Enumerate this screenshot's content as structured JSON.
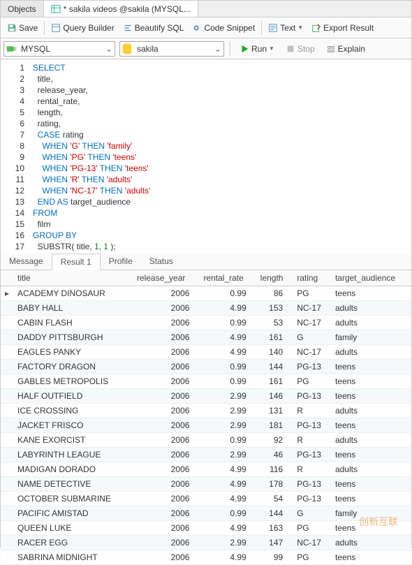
{
  "tabs": {
    "objects": "Objects",
    "file": "* sakila videos @sakila (MYSQL..."
  },
  "toolbar": {
    "save": "Save",
    "qb": "Query Builder",
    "beautify": "Beautify SQL",
    "snippet": "Code Snippet",
    "text": "Text",
    "export": "Export Result"
  },
  "combo1": "MYSQL",
  "combo2": "sakila",
  "run": "Run",
  "stop": "Stop",
  "explain": "Explain",
  "code": [
    [
      [
        "kw",
        "SELECT"
      ]
    ],
    [
      [
        "",
        "  title,"
      ]
    ],
    [
      [
        "",
        "  release_year,"
      ]
    ],
    [
      [
        "",
        "  rental_rate,"
      ]
    ],
    [
      [
        "",
        "  length,"
      ]
    ],
    [
      [
        "",
        "  rating,"
      ]
    ],
    [
      [
        "kw",
        "  CASE"
      ],
      [
        "",
        " rating"
      ]
    ],
    [
      [
        "kw",
        "    WHEN "
      ],
      [
        "str",
        "'G'"
      ],
      [
        "kw",
        " THEN "
      ],
      [
        "str",
        "'family'"
      ]
    ],
    [
      [
        "kw",
        "    WHEN "
      ],
      [
        "str",
        "'PG'"
      ],
      [
        "kw",
        " THEN "
      ],
      [
        "str",
        "'teens'"
      ]
    ],
    [
      [
        "kw",
        "    WHEN "
      ],
      [
        "str",
        "'PG-13'"
      ],
      [
        "kw",
        " THEN "
      ],
      [
        "str",
        "'teens'"
      ]
    ],
    [
      [
        "kw",
        "    WHEN "
      ],
      [
        "str",
        "'R'"
      ],
      [
        "kw",
        " THEN "
      ],
      [
        "str",
        "'adults'"
      ]
    ],
    [
      [
        "kw",
        "    WHEN "
      ],
      [
        "str",
        "'NC-17'"
      ],
      [
        "kw",
        " THEN "
      ],
      [
        "str",
        "'adults'"
      ]
    ],
    [
      [
        "kw",
        "  END AS"
      ],
      [
        "",
        " target_audience"
      ]
    ],
    [
      [
        "kw",
        "FROM"
      ]
    ],
    [
      [
        "",
        "  film"
      ]
    ],
    [
      [
        "kw",
        "GROUP BY"
      ]
    ],
    [
      [
        "",
        "  SUBSTR( title, "
      ],
      [
        "num",
        "1"
      ],
      [
        "",
        ", "
      ],
      [
        "num",
        "1"
      ],
      [
        "",
        " );"
      ]
    ]
  ],
  "btabs": {
    "msg": "Message",
    "r1": "Result 1",
    "prof": "Profile",
    "stat": "Status"
  },
  "cols": [
    "title",
    "release_year",
    "rental_rate",
    "length",
    "rating",
    "target_audience"
  ],
  "rows": [
    [
      "ACADEMY DINOSAUR",
      "2006",
      "0.99",
      "86",
      "PG",
      "teens"
    ],
    [
      "BABY HALL",
      "2006",
      "4.99",
      "153",
      "NC-17",
      "adults"
    ],
    [
      "CABIN FLASH",
      "2006",
      "0.99",
      "53",
      "NC-17",
      "adults"
    ],
    [
      "DADDY PITTSBURGH",
      "2006",
      "4.99",
      "161",
      "G",
      "family"
    ],
    [
      "EAGLES PANKY",
      "2006",
      "4.99",
      "140",
      "NC-17",
      "adults"
    ],
    [
      "FACTORY DRAGON",
      "2006",
      "0.99",
      "144",
      "PG-13",
      "teens"
    ],
    [
      "GABLES METROPOLIS",
      "2006",
      "0.99",
      "161",
      "PG",
      "teens"
    ],
    [
      "HALF OUTFIELD",
      "2006",
      "2.99",
      "146",
      "PG-13",
      "teens"
    ],
    [
      "ICE CROSSING",
      "2006",
      "2.99",
      "131",
      "R",
      "adults"
    ],
    [
      "JACKET FRISCO",
      "2006",
      "2.99",
      "181",
      "PG-13",
      "teens"
    ],
    [
      "KANE EXORCIST",
      "2006",
      "0.99",
      "92",
      "R",
      "adults"
    ],
    [
      "LABYRINTH LEAGUE",
      "2006",
      "2.99",
      "46",
      "PG-13",
      "teens"
    ],
    [
      "MADIGAN DORADO",
      "2006",
      "4.99",
      "116",
      "R",
      "adults"
    ],
    [
      "NAME DETECTIVE",
      "2006",
      "4.99",
      "178",
      "PG-13",
      "teens"
    ],
    [
      "OCTOBER SUBMARINE",
      "2006",
      "4.99",
      "54",
      "PG-13",
      "teens"
    ],
    [
      "PACIFIC AMISTAD",
      "2006",
      "0.99",
      "144",
      "G",
      "family"
    ],
    [
      "QUEEN LUKE",
      "2006",
      "4.99",
      "163",
      "PG",
      "teens"
    ],
    [
      "RACER EGG",
      "2006",
      "2.99",
      "147",
      "NC-17",
      "adults"
    ],
    [
      "SABRINA MIDNIGHT",
      "2006",
      "4.99",
      "99",
      "PG",
      "teens"
    ]
  ],
  "watermark": "创新互联"
}
